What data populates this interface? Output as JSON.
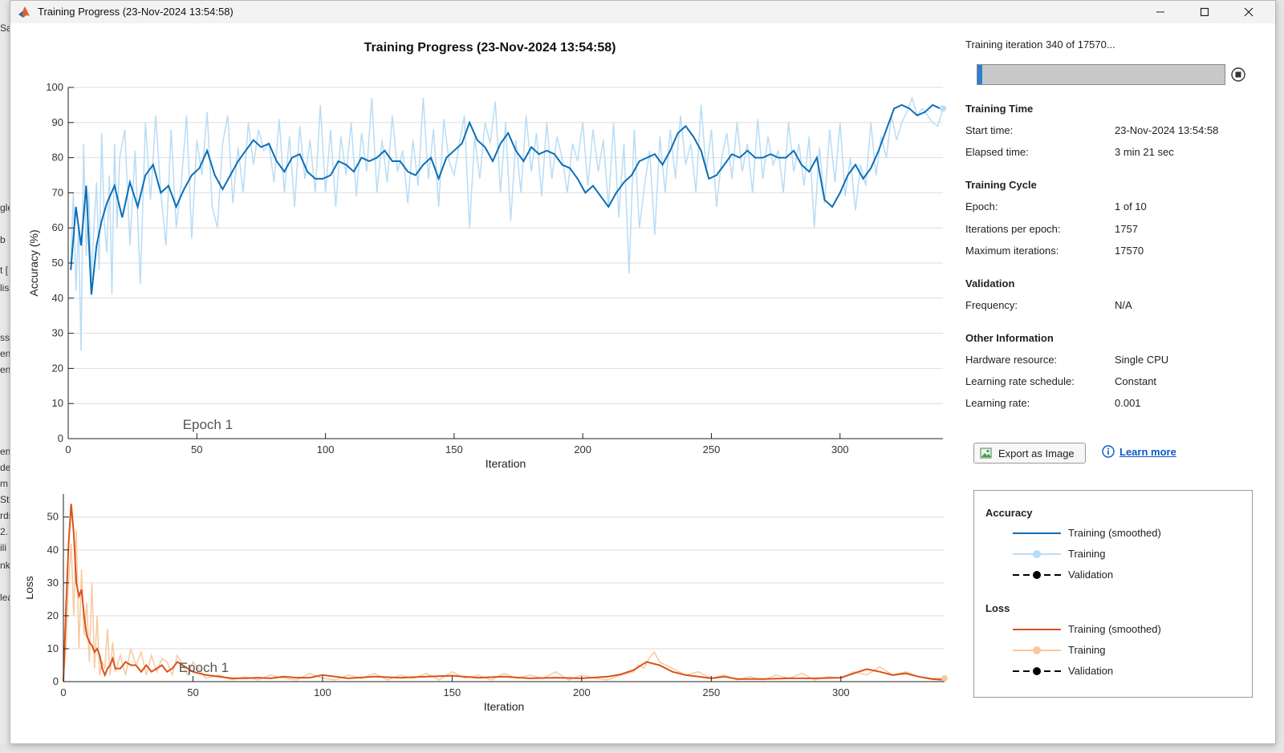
{
  "window": {
    "title": "Training Progress (23-Nov-2024 13:54:58)"
  },
  "plot_title": "Training Progress (23-Nov-2024 13:54:58)",
  "background_fragments": [
    "Sa",
    "gle",
    "b",
    "t [",
    "lis",
    "ss",
    "en",
    "en",
    "en",
    "de",
    "m",
    "Str",
    "rds",
    "2.",
    "ili",
    "nk",
    "lea"
  ],
  "status": {
    "iteration_text": "Training iteration 340 of 17570...",
    "progress_fraction": 0.0194
  },
  "info": {
    "training_time": {
      "header": "Training Time",
      "start_label": "Start time:",
      "start_value": "23-Nov-2024 13:54:58",
      "elapsed_label": "Elapsed time:",
      "elapsed_value": "3 min 21 sec"
    },
    "training_cycle": {
      "header": "Training Cycle",
      "epoch_label": "Epoch:",
      "epoch_value": "1 of 10",
      "ipe_label": "Iterations per epoch:",
      "ipe_value": "1757",
      "max_label": "Maximum iterations:",
      "max_value": "17570"
    },
    "validation": {
      "header": "Validation",
      "freq_label": "Frequency:",
      "freq_value": "N/A"
    },
    "other": {
      "header": "Other Information",
      "hw_label": "Hardware resource:",
      "hw_value": "Single CPU",
      "lrs_label": "Learning rate schedule:",
      "lrs_value": "Constant",
      "lr_label": "Learning rate:",
      "lr_value": "0.001"
    }
  },
  "buttons": {
    "export": "Export as Image",
    "learn_more": "Learn more"
  },
  "legend": {
    "accuracy_header": "Accuracy",
    "loss_header": "Loss",
    "acc_items": [
      "Training (smoothed)",
      "Training",
      "Validation"
    ],
    "loss_items": [
      "Training (smoothed)",
      "Training",
      "Validation"
    ]
  },
  "colors": {
    "acc_smoothed": "#0b6eb5",
    "acc_raw": "#b9dcf5",
    "loss_smoothed": "#d95319",
    "loss_raw": "#f8c99e",
    "validation": "#000000"
  },
  "chart_data": [
    {
      "type": "line",
      "ylabel": "Accuracy (%)",
      "xlabel": "Iteration",
      "xlim": [
        0,
        340
      ],
      "ylim": [
        0,
        100
      ],
      "xticks": [
        0,
        50,
        100,
        150,
        200,
        250,
        300
      ],
      "yticks": [
        0,
        10,
        20,
        30,
        40,
        50,
        60,
        70,
        80,
        90,
        100
      ],
      "grid": true,
      "annotation": "Epoch 1",
      "series": [
        {
          "name": "Training (smoothed)",
          "x": [
            1,
            3,
            5,
            7,
            9,
            11,
            13,
            15,
            18,
            21,
            24,
            27,
            30,
            33,
            36,
            39,
            42,
            45,
            48,
            51,
            54,
            57,
            60,
            63,
            66,
            69,
            72,
            75,
            78,
            81,
            84,
            87,
            90,
            93,
            96,
            99,
            102,
            105,
            108,
            111,
            114,
            117,
            120,
            123,
            126,
            129,
            132,
            135,
            138,
            141,
            144,
            147,
            150,
            153,
            156,
            159,
            162,
            165,
            168,
            171,
            174,
            177,
            180,
            183,
            186,
            189,
            192,
            195,
            198,
            201,
            204,
            207,
            210,
            213,
            216,
            219,
            222,
            225,
            228,
            231,
            234,
            237,
            240,
            243,
            246,
            249,
            252,
            255,
            258,
            261,
            264,
            267,
            270,
            273,
            276,
            279,
            282,
            285,
            288,
            291,
            294,
            297,
            300,
            303,
            306,
            309,
            312,
            315,
            318,
            321,
            324,
            327,
            330,
            333,
            336,
            339
          ],
          "y": [
            48,
            66,
            55,
            72,
            41,
            55,
            62,
            67,
            72,
            63,
            73,
            66,
            75,
            78,
            70,
            72,
            66,
            71,
            75,
            77,
            82,
            75,
            71,
            75,
            79,
            82,
            85,
            83,
            84,
            79,
            76,
            80,
            81,
            76,
            74,
            74,
            75,
            79,
            78,
            76,
            80,
            79,
            80,
            82,
            79,
            79,
            76,
            75,
            78,
            80,
            74,
            80,
            82,
            84,
            90,
            85,
            83,
            79,
            84,
            87,
            82,
            79,
            83,
            81,
            82,
            81,
            78,
            77,
            74,
            70,
            72,
            69,
            66,
            70,
            73,
            75,
            79,
            80,
            81,
            78,
            82,
            87,
            89,
            86,
            82,
            74,
            75,
            78,
            81,
            80,
            82,
            80,
            80,
            81,
            80,
            80,
            82,
            78,
            76,
            80,
            68,
            66,
            70,
            75,
            78,
            74,
            77,
            82,
            88,
            94,
            95,
            94,
            92,
            93,
            95,
            94
          ],
          "color": "#0b6eb5"
        },
        {
          "name": "Training",
          "x": [
            1,
            2,
            3,
            4,
            5,
            6,
            7,
            8,
            9,
            10,
            11,
            12,
            13,
            14,
            15,
            16,
            17,
            18,
            19,
            20,
            22,
            24,
            26,
            28,
            30,
            32,
            34,
            36,
            38,
            40,
            42,
            44,
            46,
            48,
            50,
            52,
            54,
            56,
            58,
            60,
            62,
            64,
            66,
            68,
            70,
            72,
            74,
            76,
            78,
            80,
            82,
            84,
            86,
            88,
            90,
            92,
            94,
            96,
            98,
            100,
            102,
            104,
            106,
            108,
            110,
            112,
            114,
            116,
            118,
            120,
            122,
            124,
            126,
            128,
            130,
            132,
            134,
            136,
            138,
            140,
            142,
            144,
            146,
            148,
            150,
            152,
            154,
            156,
            158,
            160,
            162,
            164,
            166,
            168,
            170,
            172,
            174,
            176,
            178,
            180,
            182,
            184,
            186,
            188,
            190,
            192,
            194,
            196,
            198,
            200,
            202,
            204,
            206,
            208,
            210,
            212,
            214,
            216,
            218,
            220,
            222,
            224,
            226,
            228,
            230,
            232,
            234,
            236,
            238,
            240,
            242,
            244,
            246,
            248,
            250,
            252,
            254,
            256,
            258,
            260,
            262,
            264,
            266,
            268,
            270,
            272,
            274,
            276,
            278,
            280,
            282,
            284,
            286,
            288,
            290,
            292,
            294,
            296,
            298,
            300,
            302,
            304,
            306,
            308,
            310,
            312,
            314,
            316,
            318,
            320,
            322,
            324,
            326,
            328,
            330,
            332,
            334,
            336,
            338,
            340
          ],
          "y": [
            50,
            70,
            42,
            61,
            25,
            84,
            52,
            70,
            45,
            60,
            73,
            48,
            87,
            62,
            53,
            75,
            41,
            84,
            60,
            80,
            88,
            55,
            82,
            44,
            90,
            68,
            92,
            70,
            55,
            88,
            60,
            73,
            92,
            57,
            85,
            75,
            93,
            66,
            60,
            84,
            92,
            67,
            83,
            70,
            90,
            78,
            88,
            82,
            84,
            73,
            91,
            70,
            86,
            66,
            89,
            74,
            85,
            70,
            95,
            70,
            88,
            66,
            86,
            75,
            90,
            69,
            87,
            76,
            97,
            70,
            85,
            73,
            92,
            76,
            82,
            67,
            85,
            72,
            97,
            74,
            88,
            66,
            91,
            79,
            75,
            84,
            92,
            60,
            86,
            74,
            90,
            84,
            96,
            70,
            90,
            62,
            85,
            70,
            92,
            76,
            87,
            69,
            90,
            74,
            86,
            80,
            70,
            84,
            79,
            90,
            72,
            88,
            76,
            85,
            66,
            90,
            63,
            84,
            47,
            88,
            60,
            72,
            82,
            58,
            86,
            70,
            88,
            74,
            92,
            78,
            84,
            70,
            95,
            76,
            88,
            66,
            80,
            87,
            74,
            90,
            76,
            84,
            70,
            91,
            74,
            86,
            78,
            82,
            70,
            90,
            76,
            84,
            72,
            86,
            60,
            83,
            67,
            88,
            73,
            90,
            69,
            80,
            65,
            78,
            72,
            90,
            75,
            86,
            80,
            92,
            85,
            90,
            93,
            97,
            92,
            94,
            92,
            90,
            89,
            94
          ]
        }
      ]
    },
    {
      "type": "line",
      "ylabel": "Loss",
      "xlabel": "Iteration",
      "xlim": [
        0,
        340
      ],
      "ylim": [
        0,
        57
      ],
      "xticks": [
        0,
        50,
        100,
        150,
        200,
        250,
        300
      ],
      "yticks": [
        0,
        10,
        20,
        30,
        40,
        50
      ],
      "grid": true,
      "annotation": "Epoch 1",
      "series": [
        {
          "name": "Training (smoothed)",
          "x": [
            0,
            1,
            2,
            3,
            4,
            5,
            6,
            7,
            8,
            9,
            10,
            11,
            12,
            13,
            14,
            15,
            16,
            17,
            18,
            19,
            20,
            22,
            24,
            26,
            28,
            30,
            32,
            34,
            36,
            38,
            40,
            42,
            44,
            46,
            48,
            50,
            55,
            60,
            65,
            70,
            75,
            80,
            85,
            90,
            95,
            100,
            110,
            120,
            130,
            140,
            150,
            160,
            170,
            180,
            190,
            200,
            210,
            215,
            220,
            225,
            230,
            235,
            240,
            245,
            250,
            255,
            260,
            270,
            280,
            290,
            300,
            305,
            310,
            315,
            320,
            325,
            330,
            335,
            340
          ],
          "y": [
            0,
            22,
            42,
            54,
            45,
            30,
            26,
            28,
            20,
            14,
            12,
            11,
            9,
            10,
            8,
            4,
            2,
            4,
            5,
            7,
            4,
            4,
            6,
            5,
            5,
            3,
            5,
            3,
            4,
            5,
            3,
            4,
            6,
            5,
            4,
            3,
            2,
            1.5,
            1,
            1,
            1.2,
            1,
            1.5,
            1.2,
            1.2,
            2,
            1,
            1.5,
            1.2,
            1.5,
            1.8,
            1.2,
            1.5,
            1,
            1.2,
            1,
            1.5,
            2.2,
            3.5,
            6,
            5,
            3,
            2,
            1.5,
            1,
            1.5,
            0.8,
            0.8,
            1,
            1,
            1.2,
            2.5,
            3.8,
            3,
            2,
            2.5,
            1.5,
            0.8,
            0.5
          ],
          "color": "#d95319"
        },
        {
          "name": "Training",
          "x": [
            0,
            1,
            2,
            3,
            4,
            5,
            6,
            7,
            8,
            9,
            10,
            11,
            12,
            13,
            14,
            15,
            16,
            17,
            18,
            19,
            20,
            22,
            24,
            26,
            28,
            30,
            32,
            34,
            36,
            38,
            40,
            42,
            44,
            46,
            48,
            50,
            55,
            60,
            65,
            70,
            75,
            80,
            85,
            90,
            95,
            100,
            105,
            110,
            115,
            120,
            125,
            130,
            135,
            140,
            145,
            150,
            155,
            160,
            165,
            170,
            175,
            180,
            185,
            190,
            195,
            200,
            205,
            210,
            215,
            220,
            222,
            224,
            226,
            228,
            230,
            235,
            240,
            245,
            250,
            255,
            260,
            265,
            270,
            275,
            280,
            285,
            290,
            295,
            300,
            305,
            310,
            315,
            320,
            325,
            330,
            335,
            340
          ],
          "y": [
            1,
            10,
            30,
            42,
            20,
            46,
            10,
            34,
            14,
            24,
            6,
            30,
            4,
            20,
            2,
            6,
            4,
            16,
            2,
            12,
            3,
            8,
            2,
            10,
            5,
            9,
            2,
            8,
            3,
            7,
            6,
            2,
            8,
            5,
            2,
            6,
            1,
            2,
            0.5,
            1.5,
            0.5,
            2,
            1,
            0.5,
            2.5,
            1,
            0.5,
            2,
            1,
            2.5,
            0.5,
            2,
            1,
            2.5,
            0.5,
            3,
            1,
            2,
            0.5,
            2.5,
            1,
            2,
            1,
            3,
            0.5,
            2,
            1,
            0.5,
            2,
            3,
            5,
            4,
            7,
            9,
            6,
            4,
            2,
            3,
            1,
            2,
            0.5,
            1.5,
            0.5,
            2,
            1,
            2.5,
            0.5,
            1.5,
            1,
            3,
            2,
            4.5,
            2,
            3,
            1.5,
            1,
            1
          ]
        }
      ]
    }
  ]
}
